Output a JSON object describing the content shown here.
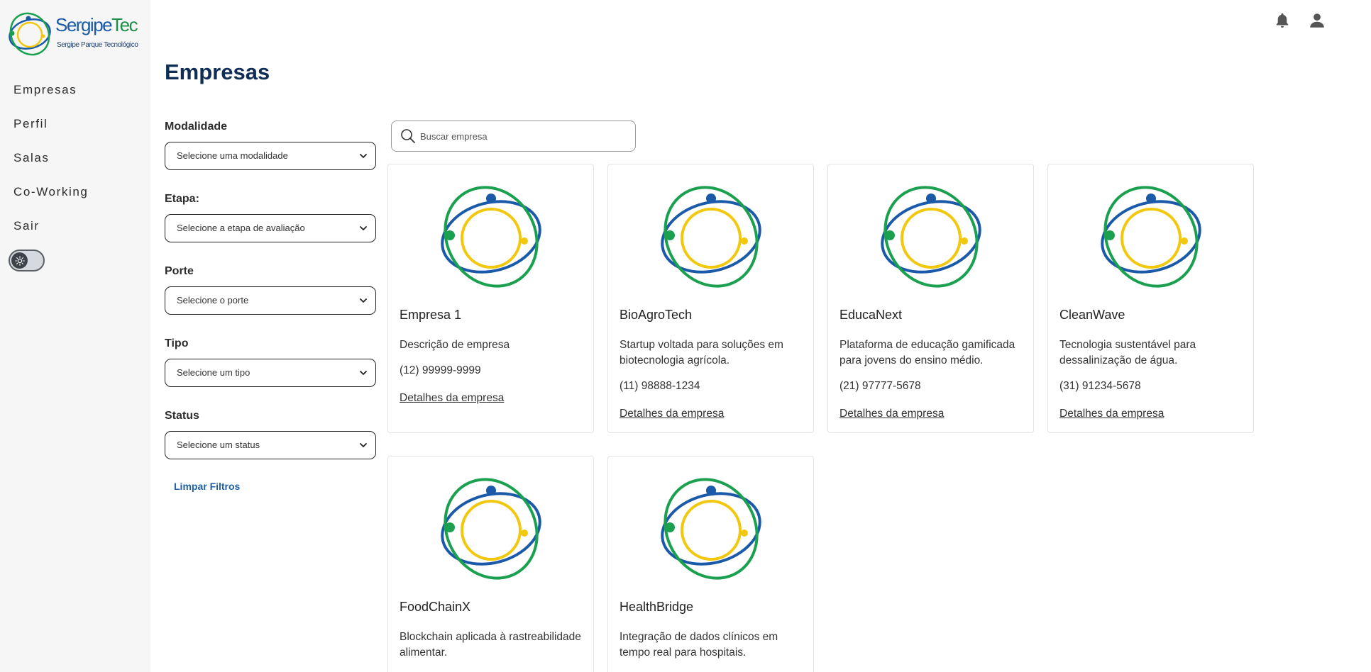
{
  "brand": {
    "name_part1": "Sergipe",
    "name_part2": "Tec",
    "subtitle": "Sergipe Parque Tecnológico"
  },
  "nav": {
    "items": [
      {
        "label": "Empresas"
      },
      {
        "label": "Perfil"
      },
      {
        "label": "Salas"
      },
      {
        "label": "Co-Working"
      },
      {
        "label": "Sair"
      }
    ]
  },
  "page": {
    "title": "Empresas"
  },
  "filters": {
    "modalidade": {
      "label": "Modalidade",
      "value": "Selecione uma modalidade"
    },
    "etapa": {
      "label": "Etapa:",
      "value": "Selecione a etapa de avaliação"
    },
    "porte": {
      "label": "Porte",
      "value": "Selecione o porte"
    },
    "tipo": {
      "label": "Tipo",
      "value": "Selecione um tipo"
    },
    "status": {
      "label": "Status",
      "value": "Selecione um status"
    },
    "clear_label": "Limpar Filtros"
  },
  "search": {
    "placeholder": "Buscar empresa",
    "value": ""
  },
  "cards": [
    {
      "name": "Empresa 1",
      "description": "Descrição de empresa",
      "phone": "(12) 99999-9999",
      "link": "Detalhes da empresa"
    },
    {
      "name": "BioAgroTech",
      "description": "Startup voltada para soluções em biotecnologia agrícola.",
      "phone": "(11) 98888-1234",
      "link": "Detalhes da empresa"
    },
    {
      "name": "EducaNext",
      "description": "Plataforma de educação gamificada para jovens do ensino médio.",
      "phone": "(21) 97777-5678",
      "link": "Detalhes da empresa"
    },
    {
      "name": "CleanWave",
      "description": "Tecnologia sustentável para dessalinização de água.",
      "phone": "(31) 91234-5678",
      "link": "Detalhes da empresa"
    },
    {
      "name": "FoodChainX",
      "description": "Blockchain aplicada à rastreabilidade alimentar.",
      "phone": "",
      "link": ""
    },
    {
      "name": "HealthBridge",
      "description": "Integração de dados clínicos em tempo real para hospitais.",
      "phone": "",
      "link": ""
    }
  ],
  "colors": {
    "blue": "#1a5aa8",
    "green": "#1aa04f",
    "yellow": "#f2c80f",
    "title": "#0f2d55",
    "link": "#1f5fa8"
  },
  "icons": {
    "notification": "bell-icon",
    "user": "user-icon",
    "theme": "sun-icon",
    "search": "search-icon",
    "select": "chevron-down-icon"
  }
}
